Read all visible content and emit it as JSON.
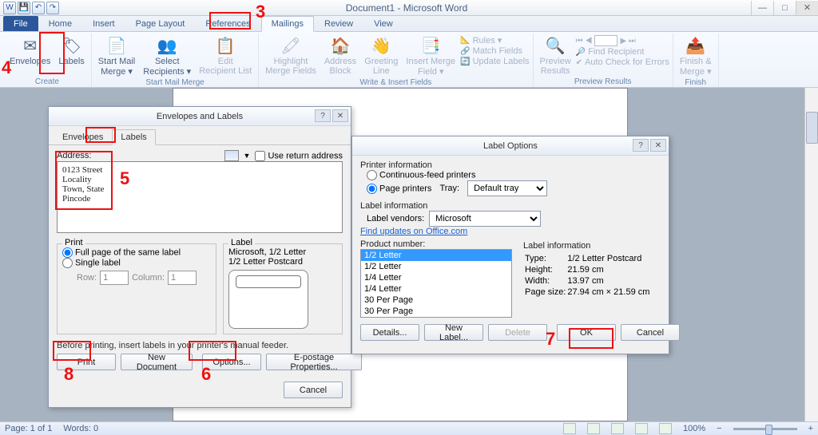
{
  "window": {
    "title": "Document1 - Microsoft Word"
  },
  "tabs": {
    "file": "File",
    "home": "Home",
    "insert": "Insert",
    "page_layout": "Page Layout",
    "references": "References",
    "mailings": "Mailings",
    "review": "Review",
    "view": "View"
  },
  "ribbon": {
    "create": {
      "envelopes": "Envelopes",
      "labels": "Labels",
      "group": "Create"
    },
    "start": {
      "start_mail_merge": "Start Mail\nMerge ▾",
      "select_recipients": "Select\nRecipients ▾",
      "edit_recipient": "Edit\nRecipient List",
      "group": "Start Mail Merge"
    },
    "write": {
      "highlight": "Highlight\nMerge Fields",
      "address": "Address\nBlock",
      "greeting": "Greeting\nLine",
      "insert_field": "Insert Merge\nField ▾",
      "rules": "Rules ▾",
      "match": "Match Fields",
      "update": "Update Labels",
      "group": "Write & Insert Fields"
    },
    "preview": {
      "preview_btn": "Preview\nResults",
      "find": "Find Recipient",
      "auto": "Auto Check for Errors",
      "group": "Preview Results"
    },
    "finish": {
      "finish_btn": "Finish &\nMerge ▾",
      "group": "Finish"
    }
  },
  "env_dialog": {
    "title": "Envelopes and Labels",
    "tab_env": "Envelopes",
    "tab_lbl": "Labels",
    "address_label": "Address:",
    "use_return": "Use return address",
    "address_text": "0123 Street\nLocality\nTown, State\nPincode",
    "print_group": "Print",
    "full_page": "Full page of the same label",
    "single": "Single label",
    "row_lbl": "Row:",
    "row_val": "1",
    "col_lbl": "Column:",
    "col_val": "1",
    "label_group": "Label",
    "label_info1": "Microsoft, 1/2 Letter",
    "label_info2": "1/2 Letter Postcard",
    "hint": "Before printing, insert labels in your printer's manual feeder.",
    "btn_print": "Print",
    "btn_newdoc": "New Document",
    "btn_options": "Options...",
    "btn_epostage": "E-postage Properties...",
    "btn_cancel": "Cancel"
  },
  "lblopt_dialog": {
    "title": "Label Options",
    "printer_info": "Printer information",
    "cont_feed": "Continuous-feed printers",
    "page_printers": "Page printers",
    "tray_lbl": "Tray:",
    "tray_val": "Default tray",
    "label_info_hdr": "Label information",
    "vendors_lbl": "Label vendors:",
    "vendors_val": "Microsoft",
    "find_updates": "Find updates on Office.com",
    "product_lbl": "Product number:",
    "products": [
      "1/2 Letter",
      "1/2 Letter",
      "1/4 Letter",
      "1/4 Letter",
      "30 Per Page",
      "30 Per Page"
    ],
    "info_hdr": "Label information",
    "info_type_k": "Type:",
    "info_type_v": "1/2 Letter Postcard",
    "info_h_k": "Height:",
    "info_h_v": "21.59 cm",
    "info_w_k": "Width:",
    "info_w_v": "13.97 cm",
    "info_ps_k": "Page size:",
    "info_ps_v": "27.94 cm × 21.59 cm",
    "btn_details": "Details...",
    "btn_newlabel": "New Label...",
    "btn_delete": "Delete",
    "btn_ok": "OK",
    "btn_cancel": "Cancel"
  },
  "status": {
    "page": "Page: 1 of 1",
    "words": "Words: 0",
    "zoom": "100%"
  },
  "annotations": {
    "n3": "3",
    "n4": "4",
    "n5": "5",
    "n6": "6",
    "n7": "7",
    "n8": "8"
  }
}
